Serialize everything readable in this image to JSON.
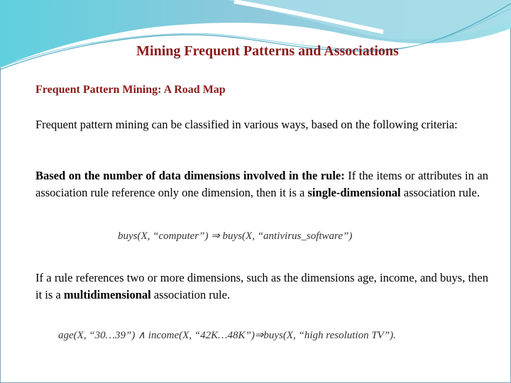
{
  "slide": {
    "title": "Mining Frequent Patterns and Associations",
    "subtitle": "Frequent Pattern Mining: A Road Map",
    "para1": "Frequent pattern mining can be classified in various ways, based on the following criteria:",
    "para2": {
      "lead_bold": "Based on the number of data dimensions involved in the rule:",
      "text1": " If the items or attributes in an association rule reference only one dimension, then it is a ",
      "bold": "single-dimensional",
      "text2": " association rule."
    },
    "formula1": "buys(X, “computer”) ⇒ buys(X, “antivirus_software”)",
    "para3": {
      "text1": "If a rule references two or more dimensions, such as the dimensions age, income, and buys, then it is a ",
      "bold": "multidimensional",
      "text2": " association rule."
    },
    "formula2": "age(X, “30…39”) ∧ income(X, “42K…48K”)⇒buys(X, “high resolution TV”).",
    "colors": {
      "title": "#8b1a1a",
      "header_wave": "#5ec8dc"
    }
  }
}
